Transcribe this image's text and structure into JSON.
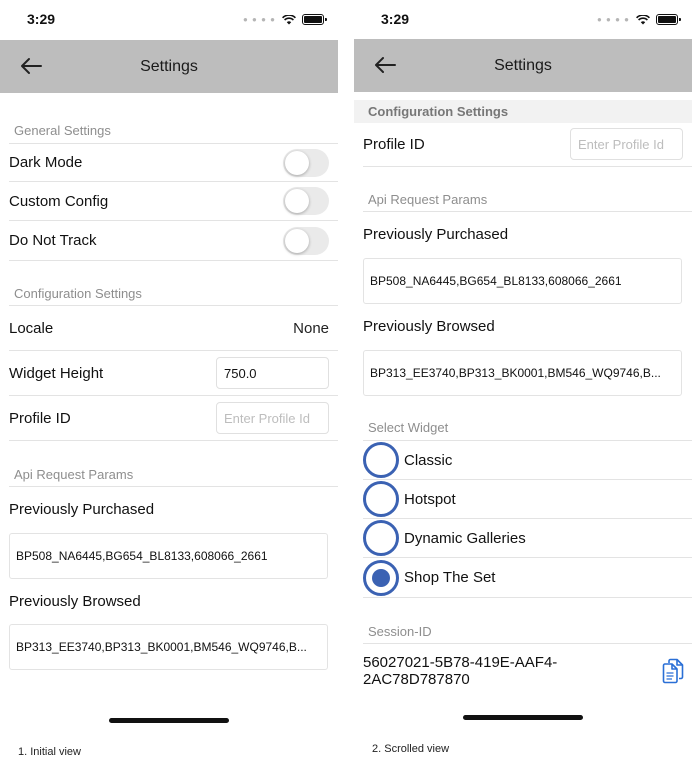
{
  "left": {
    "status": {
      "time": "3:29"
    },
    "nav": {
      "title": "Settings"
    },
    "general": {
      "header": "General Settings",
      "items": [
        {
          "label": "Dark Mode",
          "on": false
        },
        {
          "label": "Custom Config",
          "on": false
        },
        {
          "label": "Do Not Track",
          "on": false
        }
      ]
    },
    "config": {
      "header": "Configuration Settings",
      "locale_label": "Locale",
      "locale_value": "None",
      "widget_height_label": "Widget Height",
      "widget_height_value": "750.0",
      "profile_label": "Profile ID",
      "profile_placeholder": "Enter Profile Id"
    },
    "api": {
      "header": "Api Request Params",
      "purchased_label": "Previously Purchased",
      "purchased_value": "BP508_NA6445,BG654_BL8133,608066_2661",
      "browsed_label": "Previously Browsed",
      "browsed_value": "BP313_EE3740,BP313_BK0001,BM546_WQ9746,B..."
    },
    "caption": "1. Initial view"
  },
  "right": {
    "status": {
      "time": "3:29"
    },
    "nav": {
      "title": "Settings"
    },
    "config": {
      "header": "Configuration Settings",
      "profile_label": "Profile ID",
      "profile_placeholder": "Enter Profile Id"
    },
    "api": {
      "header": "Api Request Params",
      "purchased_label": "Previously Purchased",
      "purchased_value": "BP508_NA6445,BG654_BL8133,608066_2661",
      "browsed_label": "Previously Browsed",
      "browsed_value": "BP313_EE3740,BP313_BK0001,BM546_WQ9746,B..."
    },
    "widget": {
      "header": "Select Widget",
      "options": [
        {
          "label": "Classic",
          "selected": false
        },
        {
          "label": "Hotspot",
          "selected": false
        },
        {
          "label": "Dynamic Galleries",
          "selected": false
        },
        {
          "label": "Shop The Set",
          "selected": true
        }
      ]
    },
    "session": {
      "header": "Session-ID",
      "value": "56027021-5B78-419E-AAF4-2AC78D787870"
    },
    "caption": "2. Scrolled view"
  },
  "colors": {
    "nav_bar": "#bdbdbd",
    "radio_accent": "#3b62b3",
    "copy_icon": "#2a6fd6"
  },
  "icons": [
    "back-arrow-icon",
    "wifi-icon",
    "battery-icon",
    "signal-icon",
    "copy-icon"
  ]
}
